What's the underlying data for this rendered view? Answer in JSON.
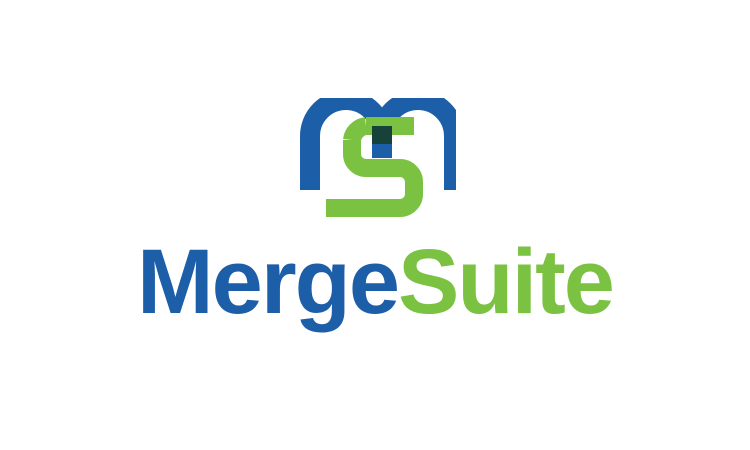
{
  "brand": {
    "name_part_1": "Merge",
    "name_part_2": "Suite",
    "logo_icon": "ms-monogram-icon"
  },
  "colors": {
    "background": "#ffffff",
    "primary_blue": "#1d5ea9",
    "accent_green": "#7cc242",
    "overlap_dark": "#17423a"
  }
}
